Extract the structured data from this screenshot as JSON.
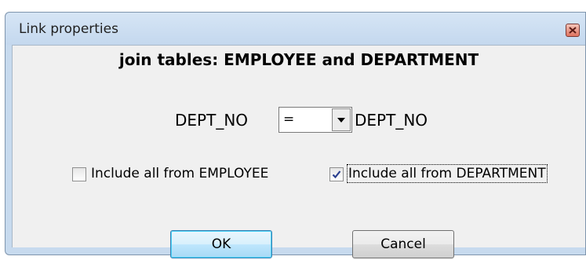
{
  "window": {
    "title": "Link properties"
  },
  "dialog": {
    "heading": "join tables: EMPLOYEE and DEPARTMENT",
    "left_field": "DEPT_NO",
    "operator": {
      "selected": "="
    },
    "right_field": "DEPT_NO",
    "checkboxes": [
      {
        "label": "Include all from EMPLOYEE",
        "checked": false
      },
      {
        "label": "Include all from DEPARTMENT",
        "checked": true
      }
    ],
    "ok_label": "OK",
    "cancel_label": "Cancel"
  },
  "icons": {
    "close": "close-icon",
    "dropdown": "chevron-down-icon",
    "check": "check-icon"
  },
  "colors": {
    "titlebar": "#c7daee",
    "client": "#f0f0f0",
    "default_button_border": "#3c7fb1",
    "check_mark": "#2a3f8f"
  }
}
